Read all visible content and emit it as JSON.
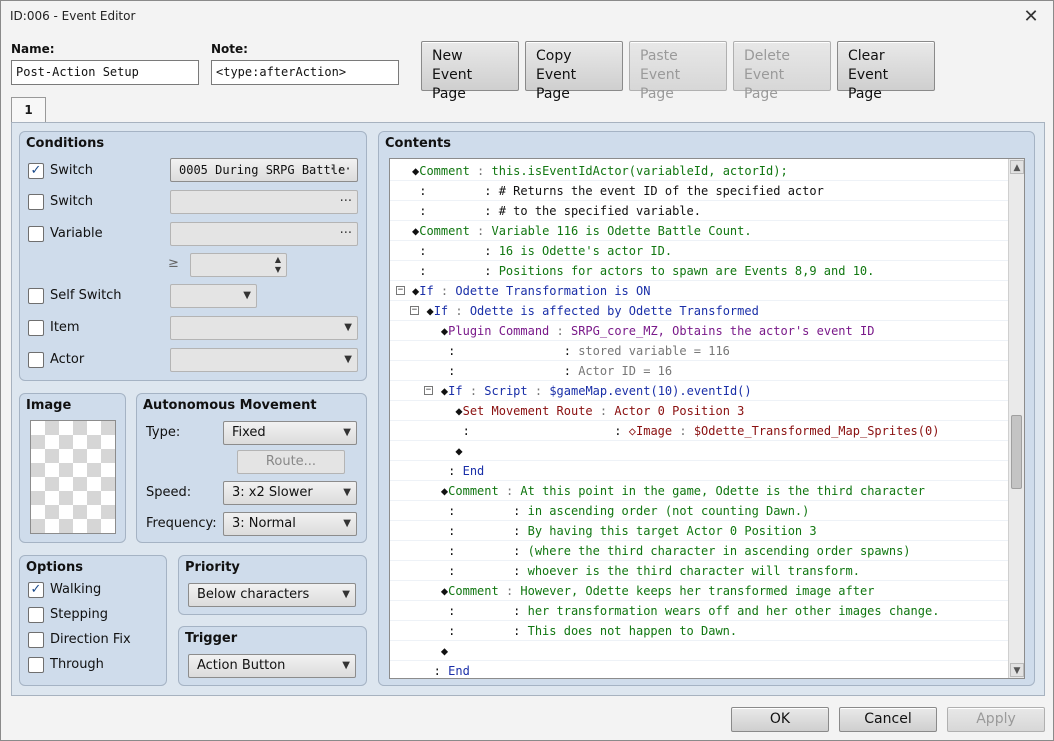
{
  "window": {
    "title": "ID:006 - Event Editor",
    "close_glyph": "✕"
  },
  "header": {
    "name_label": "Name:",
    "name_value": "Post-Action Setup",
    "note_label": "Note:",
    "note_value": "<type:afterAction>",
    "buttons": [
      {
        "line1": "New",
        "line2": "Event Page",
        "enabled": true
      },
      {
        "line1": "Copy",
        "line2": "Event Page",
        "enabled": true
      },
      {
        "line1": "Paste",
        "line2": "Event Page",
        "enabled": false
      },
      {
        "line1": "Delete",
        "line2": "Event Page",
        "enabled": false
      },
      {
        "line1": "Clear",
        "line2": "Event Page",
        "enabled": true
      }
    ]
  },
  "tabs": [
    {
      "label": "1"
    }
  ],
  "conditions": {
    "title": "Conditions",
    "switch1": {
      "label": "Switch",
      "checked": true,
      "value": "0005 During SRPG Battle"
    },
    "switch2": {
      "label": "Switch",
      "checked": false,
      "value": ""
    },
    "variable": {
      "label": "Variable",
      "checked": false,
      "value": ""
    },
    "ge_symbol": "≥",
    "self_switch": {
      "label": "Self Switch",
      "checked": false
    },
    "item": {
      "label": "Item",
      "checked": false
    },
    "actor": {
      "label": "Actor",
      "checked": false
    },
    "ellipsis": "···",
    "check_glyph": "✓"
  },
  "image": {
    "title": "Image"
  },
  "movement": {
    "title": "Autonomous Movement",
    "type_label": "Type:",
    "type_value": "Fixed",
    "route_label": "Route...",
    "speed_label": "Speed:",
    "speed_value": "3: x2 Slower",
    "frequency_label": "Frequency:",
    "frequency_value": "3: Normal"
  },
  "options": {
    "title": "Options",
    "items": [
      {
        "label": "Walking",
        "checked": true
      },
      {
        "label": "Stepping",
        "checked": false
      },
      {
        "label": "Direction Fix",
        "checked": false
      },
      {
        "label": "Through",
        "checked": false
      }
    ]
  },
  "priority": {
    "title": "Priority",
    "value": "Below characters"
  },
  "trigger": {
    "title": "Trigger",
    "value": "Action Button"
  },
  "contents": {
    "title": "Contents",
    "rows": [
      {
        "indent": "",
        "collapse": false,
        "segments": [
          [
            "black",
            "◆"
          ],
          [
            "green",
            "Comment"
          ],
          [
            "gray",
            " : "
          ],
          [
            "green",
            "this.isEventIdActor(variableId, actorId);"
          ]
        ]
      },
      {
        "indent": "",
        "collapse": false,
        "segments": [
          [
            "black",
            " :"
          ],
          [
            "black",
            "        : "
          ],
          [
            "black",
            "# Returns the event ID of the specified actor"
          ]
        ]
      },
      {
        "indent": "",
        "collapse": false,
        "segments": [
          [
            "black",
            " :"
          ],
          [
            "black",
            "        : "
          ],
          [
            "black",
            "# to the specified variable."
          ]
        ]
      },
      {
        "indent": "",
        "collapse": false,
        "segments": [
          [
            "black",
            "◆"
          ],
          [
            "green",
            "Comment"
          ],
          [
            "gray",
            " : "
          ],
          [
            "green",
            "Variable 116 is Odette Battle Count."
          ]
        ]
      },
      {
        "indent": "",
        "collapse": false,
        "segments": [
          [
            "black",
            " :"
          ],
          [
            "black",
            "        : "
          ],
          [
            "green",
            "16 is Odette's actor ID."
          ]
        ]
      },
      {
        "indent": "",
        "collapse": false,
        "segments": [
          [
            "black",
            " :"
          ],
          [
            "black",
            "        : "
          ],
          [
            "green",
            "Positions for actors to spawn are Events 8,9 and 10."
          ]
        ]
      },
      {
        "indent": "",
        "collapse": true,
        "segments": [
          [
            "black",
            "◆"
          ],
          [
            "blue",
            "If"
          ],
          [
            "gray",
            " : "
          ],
          [
            "blue",
            "Odette Transformation is ON"
          ]
        ]
      },
      {
        "indent": "  ",
        "collapse": true,
        "segments": [
          [
            "black",
            "◆"
          ],
          [
            "blue",
            "If"
          ],
          [
            "gray",
            " : "
          ],
          [
            "blue",
            "Odette is affected by Odette Transformed"
          ]
        ]
      },
      {
        "indent": "    ",
        "collapse": false,
        "segments": [
          [
            "black",
            "◆"
          ],
          [
            "purple",
            "Plugin Command"
          ],
          [
            "gray",
            " : "
          ],
          [
            "purple",
            "SRPG_core_MZ, Obtains the actor's event ID"
          ]
        ]
      },
      {
        "indent": "    ",
        "collapse": false,
        "segments": [
          [
            "black",
            " :"
          ],
          [
            "black",
            "               : "
          ],
          [
            "gray",
            "stored variable = 116"
          ]
        ]
      },
      {
        "indent": "    ",
        "collapse": false,
        "segments": [
          [
            "black",
            " :"
          ],
          [
            "black",
            "               : "
          ],
          [
            "gray",
            "Actor ID = 16"
          ]
        ]
      },
      {
        "indent": "    ",
        "collapse": true,
        "segments": [
          [
            "black",
            "◆"
          ],
          [
            "blue",
            "If"
          ],
          [
            "gray",
            " : "
          ],
          [
            "blue",
            "Script"
          ],
          [
            "gray",
            " : "
          ],
          [
            "blue",
            "$gameMap.event(10).eventId()"
          ]
        ]
      },
      {
        "indent": "      ",
        "collapse": false,
        "segments": [
          [
            "black",
            "◆"
          ],
          [
            "red",
            "Set Movement Route"
          ],
          [
            "gray",
            " : "
          ],
          [
            "red",
            "Actor 0 Position 3"
          ]
        ]
      },
      {
        "indent": "      ",
        "collapse": false,
        "segments": [
          [
            "black",
            " :"
          ],
          [
            "black",
            "                    : "
          ],
          [
            "red",
            "◇Image"
          ],
          [
            "gray",
            " : "
          ],
          [
            "red",
            "$Odette_Transformed_Map_Sprites(0)"
          ]
        ]
      },
      {
        "indent": "      ",
        "collapse": false,
        "segments": [
          [
            "black",
            "◆"
          ]
        ]
      },
      {
        "indent": "    ",
        "collapse": false,
        "segments": [
          [
            "black",
            " : "
          ],
          [
            "blue",
            "End"
          ]
        ]
      },
      {
        "indent": "    ",
        "collapse": false,
        "segments": [
          [
            "black",
            "◆"
          ],
          [
            "green",
            "Comment"
          ],
          [
            "gray",
            " : "
          ],
          [
            "green",
            "At this point in the game, Odette is the third character"
          ]
        ]
      },
      {
        "indent": "    ",
        "collapse": false,
        "segments": [
          [
            "black",
            " :"
          ],
          [
            "black",
            "        : "
          ],
          [
            "green",
            "in ascending order (not counting Dawn.)"
          ]
        ]
      },
      {
        "indent": "    ",
        "collapse": false,
        "segments": [
          [
            "black",
            " :"
          ],
          [
            "black",
            "        : "
          ],
          [
            "green",
            "By having this target Actor 0 Position 3"
          ]
        ]
      },
      {
        "indent": "    ",
        "collapse": false,
        "segments": [
          [
            "black",
            " :"
          ],
          [
            "black",
            "        : "
          ],
          [
            "green",
            "(where the third character in ascending order spawns)"
          ]
        ]
      },
      {
        "indent": "    ",
        "collapse": false,
        "segments": [
          [
            "black",
            " :"
          ],
          [
            "black",
            "        : "
          ],
          [
            "green",
            "whoever is the third character will transform."
          ]
        ]
      },
      {
        "indent": "    ",
        "collapse": false,
        "segments": [
          [
            "black",
            "◆"
          ],
          [
            "green",
            "Comment"
          ],
          [
            "gray",
            " : "
          ],
          [
            "green",
            "However, Odette keeps her transformed image after"
          ]
        ]
      },
      {
        "indent": "    ",
        "collapse": false,
        "segments": [
          [
            "black",
            " :"
          ],
          [
            "black",
            "        : "
          ],
          [
            "green",
            "her transformation wears off and her other images change."
          ]
        ]
      },
      {
        "indent": "    ",
        "collapse": false,
        "segments": [
          [
            "black",
            " :"
          ],
          [
            "black",
            "        : "
          ],
          [
            "green",
            "This does not happen to Dawn."
          ]
        ]
      },
      {
        "indent": "    ",
        "collapse": false,
        "segments": [
          [
            "black",
            "◆"
          ]
        ]
      },
      {
        "indent": "  ",
        "collapse": false,
        "segments": [
          [
            "black",
            " : "
          ],
          [
            "blue",
            "End"
          ]
        ]
      }
    ]
  },
  "footer": {
    "ok": "OK",
    "cancel": "Cancel",
    "apply": "Apply"
  },
  "colors": {
    "green": "#117711",
    "blue": "#1a2fa8",
    "purple": "#7a1a8a",
    "red": "#8a1010",
    "gray": "#777777",
    "black": "#111111",
    "panel": "#cfdceb"
  }
}
